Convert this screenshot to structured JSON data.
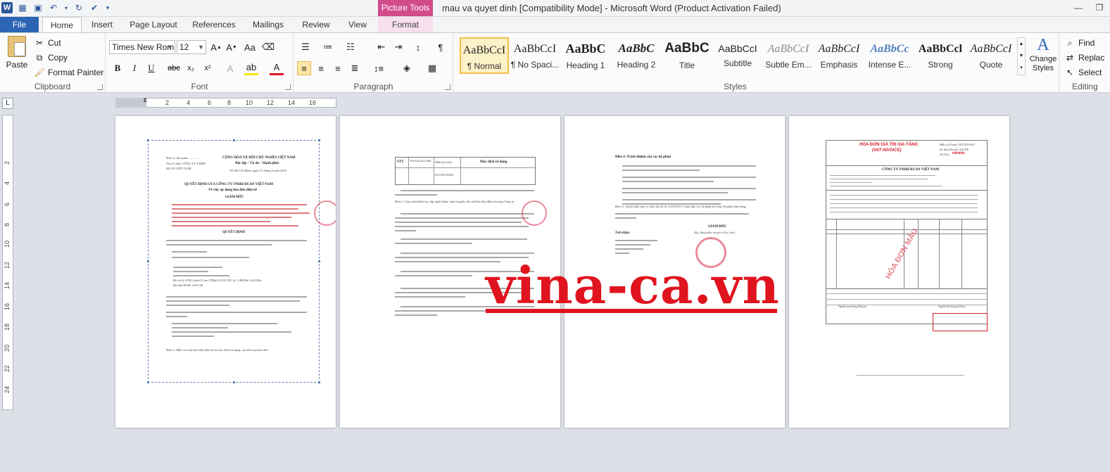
{
  "window": {
    "title": "mau va quyet dinh [Compatibility Mode]  -  Microsoft Word (Product Activation Failed)",
    "contextual_tab_group": "Picture Tools"
  },
  "tabs": [
    "File",
    "Home",
    "Insert",
    "Page Layout",
    "References",
    "Mailings",
    "Review",
    "View",
    "Format"
  ],
  "ribbon": {
    "clipboard": {
      "paste": "Paste",
      "cut": "Cut",
      "copy": "Copy",
      "format_painter": "Format Painter",
      "label": "Clipboard"
    },
    "font": {
      "name": "Times New Rom",
      "size": "12",
      "label": "Font",
      "bold": "B",
      "italic": "I",
      "underline": "U",
      "strike": "abc",
      "sub": "x₂",
      "sup": "x²"
    },
    "paragraph": {
      "label": "Paragraph"
    },
    "styles": {
      "label": "Styles",
      "items": [
        {
          "sample": "AaBbCcI",
          "name": "¶ Normal"
        },
        {
          "sample": "AaBbCcI",
          "name": "¶ No Spaci..."
        },
        {
          "sample": "AaBbC",
          "name": "Heading 1"
        },
        {
          "sample": "AaBbC",
          "name": "Heading 2"
        },
        {
          "sample": "AaBbC",
          "name": "Title"
        },
        {
          "sample": "AaBbCcI",
          "name": "Subtitle"
        },
        {
          "sample": "AaBbCcI",
          "name": "Subtle Em..."
        },
        {
          "sample": "AaBbCcI",
          "name": "Emphasis"
        },
        {
          "sample": "AaBbCc",
          "name": "Intense E..."
        },
        {
          "sample": "AaBbCcl",
          "name": "Strong"
        },
        {
          "sample": "AaBbCcI",
          "name": "Quote"
        }
      ],
      "change_styles": "Change Styles"
    },
    "editing": {
      "label": "Editing",
      "find": "Find",
      "replace": "Replac",
      "select": "Select"
    }
  },
  "ruler": {
    "horizontal": [
      "2",
      "2",
      "4",
      "6",
      "8",
      "10",
      "12",
      "14",
      "16"
    ],
    "vertical": [
      "2",
      "4",
      "6",
      "8",
      "10",
      "12",
      "14",
      "16",
      "18",
      "20",
      "22",
      "24"
    ]
  },
  "pages": {
    "page1": {
      "header_left_1": "Đơn vị chủ quản: ............",
      "header_left_2": "Tên tổ chức CÔNG TY TNHH",
      "header_left_3": "RUAN VIỆT NAM",
      "header_right_1": "CỘNG HÒA XÃ HỘI CHỦ NGHĨA VIỆT NAM",
      "header_right_2": "Độc lập – Tự do – Hạnh phúc",
      "date": "TP. Hồ Chí Minh, ngày 31 tháng 5 năm 2019",
      "title_1": "QUYẾT ĐỊNH CỦA CÔNG TY TNHH RUAN VIỆT NAM",
      "title_2": "Về việc áp dụng hóa đơn điện tử",
      "director": "GIÁM ĐỐC",
      "decision": "QUYẾT ĐỊNH",
      "article_1": "Điều 1. Áp dụng hình thức hóa đơn điện tử trong vòng từ ngày 31/05/2019 trên cơ sở hệ thống phần mềm",
      "cpu": "Bộ xử lý (CPU) Intel ICore (TM)i3-4150 CPU @ 3.40GHz 3.40 GHz",
      "ram": "Bộ nhớ RAM: 4.00 GB",
      "article_2": "Điều 2. Mẫu các loại hóa đơn điện tử và mục đích sử dụng của mỗi loại hóa đơn:"
    },
    "page2": {
      "col_stt": "STT",
      "col_type": "Tên loại hóa đơn",
      "col_form": "Mẫu hóa đơn",
      "col_purpose": "Mục đích sử dụng",
      "form_code": "01GTKT0/001",
      "article_3": "Điều 3. Quy trình khởi tạo, lập, phát hành, luân chuyển, lưu trữ hóa đơn điện tử trong Công ty:"
    },
    "page3": {
      "article_4": "Điều 4. Trách nhiệm của các bộ phận",
      "article_5": "Điều 5. Quyết định này có hiệu lực kể từ 31/05/2019. Lãnh đạo các bộ phận kế toán, bộ phận bán hàng,",
      "director": "GIÁM ĐỐC",
      "sign_note": "(Ký, đóng dấu và ghi rõ họ, tên)",
      "recipients": "Nơi nhận:"
    },
    "page4": {
      "invoice_title": "HÓA ĐƠN GIÁ TRỊ GIA TĂNG",
      "invoice_subtitle": "(VAT INVOICE)",
      "form_no": "Mẫu số (Form): 01GTKT0/001",
      "serial": "Ký hiệu (Serial): AA/19E",
      "number_label": "Số (No):",
      "number": "0000000",
      "company": "CÔNG TY TNHH RUAN VIỆT NAM",
      "sample_watermark": "HÓA ĐƠN MẪU",
      "buyer_sign": "Người mua hàng (Buyer)",
      "seller_sign": "Người bán hàng (Seller)"
    }
  },
  "watermark": "vina-ca.vn",
  "colors": {
    "file_tab": "#2b65b4",
    "picture_tools": "#d24c8c",
    "watermark": "#e0141e",
    "invoice_red": "#d21e2a"
  }
}
